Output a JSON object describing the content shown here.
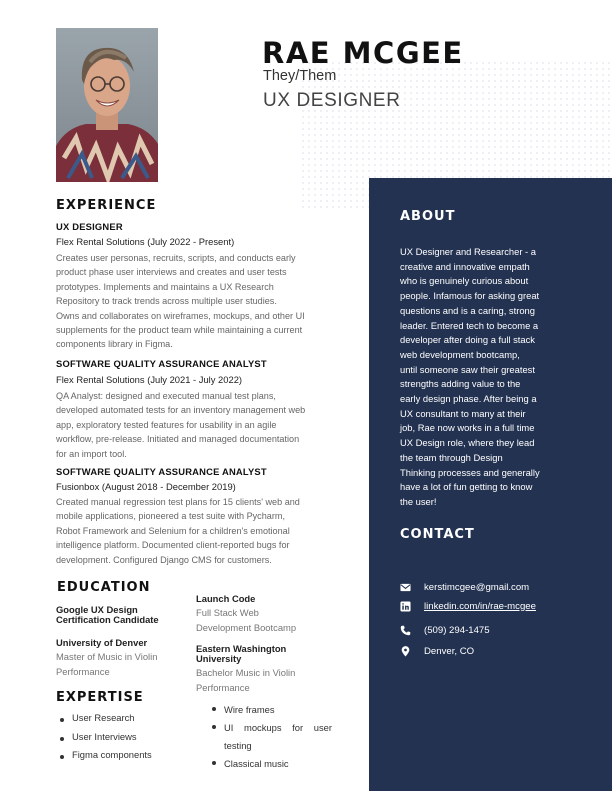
{
  "header": {
    "name": "RAE MCGEE",
    "pronouns": "They/Them",
    "title": "UX DESIGNER"
  },
  "experience": {
    "heading": "EXPERIENCE",
    "jobs": [
      {
        "title": "UX DESIGNER",
        "company": "Flex Rental Solutions (July 2022 - Present)",
        "lines": [
          "Creates user personas, recruits, scripts, and conducts early",
          "product phase user interviews and creates and user tests",
          "prototypes. Implements and maintains a UX Research",
          "Repository to track trends across multiple user studies.",
          "Owns and collaborates on wireframes, mockups, and other UI",
          "supplements for the product team while maintaining a current",
          "components library in Figma."
        ]
      },
      {
        "title": "SOFTWARE QUALITY ASSURANCE ANALYST",
        "company": "Flex Rental Solutions (July 2021 - July 2022)",
        "lines": [
          "QA Analyst: designed and executed manual test plans,",
          "developed automated tests for an inventory management web",
          "app, exploratory tested features for usability in an agile",
          "workflow, pre-release. Initiated and managed documentation",
          "for an import tool."
        ]
      },
      {
        "title": "SOFTWARE QUALITY ASSURANCE ANALYST",
        "company": "Fusionbox (August 2018 - December 2019)",
        "lines": [
          "Created manual regression test plans for 15 clients' web and",
          "mobile applications, pioneered a test suite with Pycharm,",
          "Robot Framework and Selenium for a children's emotional",
          "intelligence platform. Documented client-reported bugs for",
          "development. Configured Django CMS for customers."
        ]
      }
    ]
  },
  "education": {
    "heading": "EDUCATION",
    "items": [
      {
        "title_lines": [
          "Google UX Design",
          "Certification Candidate"
        ],
        "detail_lines": []
      },
      {
        "title_lines": [
          "University of Denver"
        ],
        "detail_lines": [
          "Master of Music in Violin",
          "Performance"
        ]
      },
      {
        "title_lines": [
          "Launch Code"
        ],
        "detail_lines": [
          "Full Stack Web",
          "Development Bootcamp"
        ]
      },
      {
        "title_lines": [
          "Eastern Washington",
          "University"
        ],
        "detail_lines": [
          "Bachelor Music in Violin",
          "Performance"
        ]
      }
    ]
  },
  "expertise": {
    "heading": "EXPERTISE",
    "col1": [
      "User Research",
      "User Interviews",
      "Figma components"
    ],
    "col2": [
      "Wire frames",
      "UI mockups for user",
      "testing",
      "Classical music"
    ]
  },
  "about": {
    "heading": "ABOUT",
    "lines": [
      "UX Designer and Researcher - a",
      "creative and innovative empath",
      "who is genuinely curious about",
      "people. Infamous for asking great",
      "questions and is a caring, strong",
      "leader. Entered tech to become a",
      "developer after doing a full stack",
      "web development bootcamp,",
      "until someone saw their greatest",
      "strengths adding value to the",
      "early design phase. After being a",
      "UX consultant to many at their",
      "job, Rae now works in a full time",
      "UX Design role, where they lead",
      "the team through  Design",
      "Thinking processes and generally",
      "have a lot of fun getting to know",
      "the user!"
    ]
  },
  "contact": {
    "heading": "CONTACT",
    "email": "kerstimcgee@gmail.com",
    "linkedin": "linkedin.com/in/rae-mcgee",
    "phone": "(509) 294-1475",
    "location": "Denver, CO",
    "icons": [
      "email-icon",
      "linkedin-icon",
      "phone-icon",
      "location-pin-icon"
    ]
  },
  "colors": {
    "panel": "#233251",
    "accent_text": "#111111"
  }
}
